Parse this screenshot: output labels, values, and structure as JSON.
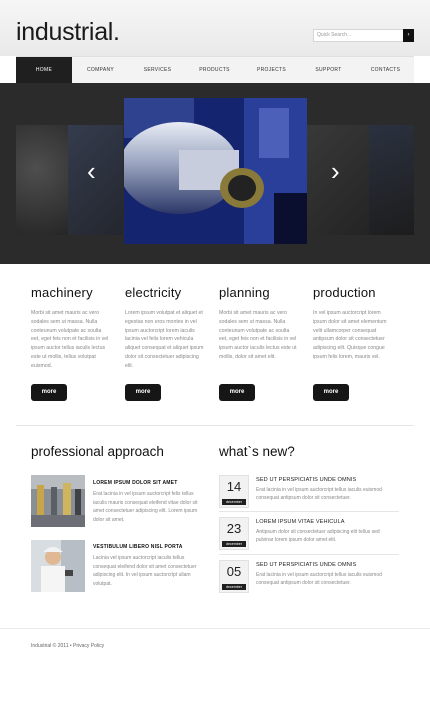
{
  "brand": {
    "logo": "industrial."
  },
  "search": {
    "placeholder": "Quick Search...",
    "button": "›"
  },
  "nav": [
    "HOME",
    "COMPANY",
    "SERVICES",
    "PRODUCTS",
    "PROJECTS",
    "SUPPORT",
    "CONTACTS"
  ],
  "slider": {
    "prev": "‹",
    "next": "›"
  },
  "features": [
    {
      "title": "machinery",
      "text": "Morbi sit amet mauris ac vero sodales sem ut massa. Nulla conteunum volutpate ac soulta eet, eget feis non et facilisis in vel ipsum auctor tellus iaculis lectus este ut mollis, tellus volutpat euismod.",
      "more": "more"
    },
    {
      "title": "electricity",
      "text": "Lorem ipsum volutpat et aliquet et egestas non eros montes in vel ipsum auctorcript lorem iaculis lacinia vel felis lorem vehicula aliquet consequat et aliquet ipsum dolor sit consectetuer adipiscing elit.",
      "more": "more"
    },
    {
      "title": "planning",
      "text": "Morbi sit amet mauris ac vero sodales sem ut massa. Nulla conteunum volutpate ac soulta eet, eget feis non et facilisis in vel ipsum auctor iaculis lectus este ut mollis, dolor sit amet elit.",
      "more": "more"
    },
    {
      "title": "production",
      "text": "In vel ipsum auctorcript lorem ipsum dolor sit amet elementum velit ullamcorper consequat antipsum dolor sit consectetuer adipiscing elit. Quisque congue ipsum felis lorem, mauris vel.",
      "more": "more"
    }
  ],
  "approach": {
    "title": "professional approach",
    "items": [
      {
        "title": "LOREM IPSUM DOLOR SIT AMET",
        "text": "Erat lacinia in vel ipsum auctorcript felis tellus iaculis mauris consequat eleifend vitae dolor sit amet consectetuer adipiscing elit. Lorem ipsum dolor sit amet."
      },
      {
        "title": "VESTIBULUM LIBERO NISL PORTA",
        "text": "Lacinia vel ipsum auctorcript iaculis tellus consequat eleifend dolor sit amet consectetuer adipiscing elit. In vel ipsum auctorcript ullam volutpat."
      }
    ]
  },
  "news": {
    "title": "what`s new?",
    "items": [
      {
        "day": "14",
        "month": "december",
        "title": "SED UT PERSPICIATIS UNDE OMNIS",
        "text": "Erat lacinia in vel ipsum auctorcript tellus iaculis euismod consequat antipsum dolor sit consectetuer."
      },
      {
        "day": "23",
        "month": "december",
        "title": "LOREM IPSUM VITAE VEHICULA",
        "text": "Antipsum dolor sit consectetuer adipiscing elit tellus sed pulvinar lorem ipsum dolor amet elit."
      },
      {
        "day": "05",
        "month": "december",
        "title": "SED UT PERSPICIATIS UNDE OMNIS",
        "text": "Erat lacinia in vel ipsum auctorcript tellus iaculis euismod consequat antipsum dolor sit consectetuer."
      }
    ]
  },
  "footer": {
    "text": "Industrial © 2011 • Privacy Policy"
  }
}
